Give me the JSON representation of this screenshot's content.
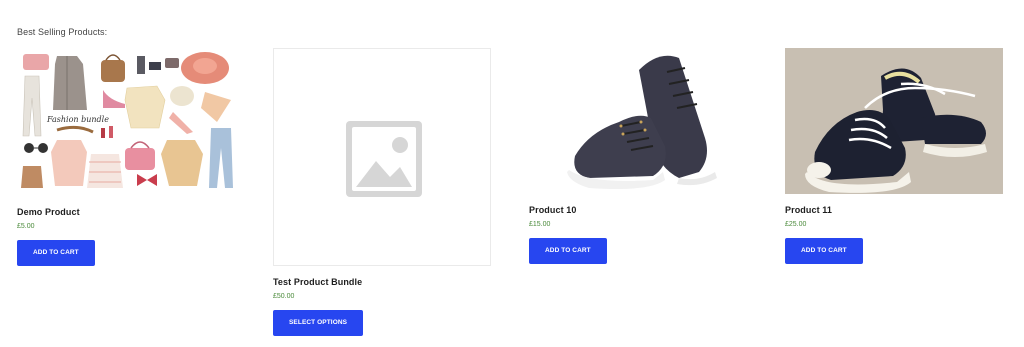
{
  "section": {
    "heading": "Best Selling Products:"
  },
  "products": [
    {
      "title": "Demo Product",
      "price": "£5.00",
      "button": "ADD TO CART",
      "image_icon": "fashion-bundle-image",
      "image_caption": "Fashion bundle"
    },
    {
      "title": "Test Product Bundle",
      "price": "£50.00",
      "button": "SELECT OPTIONS",
      "image_icon": "placeholder-image-icon"
    },
    {
      "title": "Product 10",
      "price": "£15.00",
      "button": "ADD TO CART",
      "image_icon": "sneaker-image"
    },
    {
      "title": "Product 11",
      "price": "£25.00",
      "button": "ADD TO CART",
      "image_icon": "converse-sneakers-image"
    }
  ],
  "colors": {
    "button_bg": "#2746f0",
    "price": "#4a8a3a",
    "heading": "#444444"
  }
}
